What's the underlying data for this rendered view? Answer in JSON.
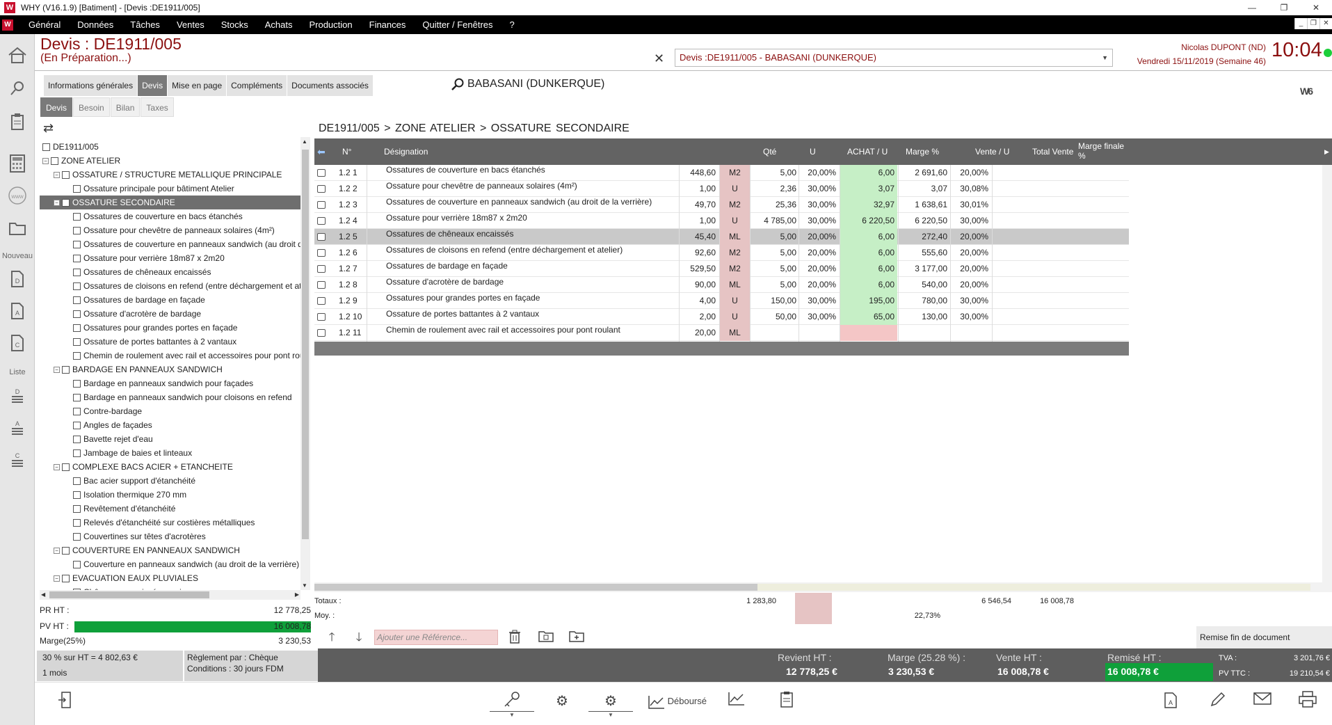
{
  "window": {
    "title": "WHY (V16.1.9)  [Batiment] - [Devis :DE1911/005]",
    "logo": "W",
    "controls": [
      "—",
      "❐",
      "✕"
    ]
  },
  "menu": {
    "items": [
      "Général",
      "Données",
      "Tâches",
      "Ventes",
      "Stocks",
      "Achats",
      "Production",
      "Finances",
      "Quitter / Fenêtres",
      "?"
    ],
    "mdi": [
      "_",
      "❐",
      "✕"
    ]
  },
  "rail": {
    "label_nouveau": "Nouveau",
    "label_liste": "Liste"
  },
  "header": {
    "title": "Devis : DE1911/005",
    "status": "(En Préparation...)",
    "doc_select": "Devis :DE1911/005 - BABASANI  (DUNKERQUE)",
    "user": "Nicolas DUPONT (ND)",
    "date": "Vendredi 15/11/2019 (Semaine 46)",
    "time": "10:04"
  },
  "tabs": {
    "main": [
      "Informations générales",
      "Devis",
      "Mise en page",
      "Compléments",
      "Documents associés"
    ],
    "sub": [
      "Devis",
      "Besoin",
      "Bilan",
      "Taxes"
    ]
  },
  "client": "BABASANI  (DUNKERQUE)",
  "brand_mark": "W6",
  "tree": [
    {
      "label": "DE1911/005",
      "level": 0,
      "exp": ""
    },
    {
      "label": "ZONE ATELIER",
      "level": 1,
      "exp": "−"
    },
    {
      "label": "OSSATURE / STRUCTURE METALLIQUE PRINCIPALE",
      "level": 2,
      "exp": "−"
    },
    {
      "label": "Ossature principale pour bâtiment Atelier",
      "level": 3,
      "exp": ""
    },
    {
      "label": "OSSATURE SECONDAIRE",
      "level": 2,
      "exp": "−",
      "selected": true
    },
    {
      "label": "Ossatures de couverture en bacs étanchés",
      "level": 3,
      "exp": ""
    },
    {
      "label": "Ossature pour chevêtre de panneaux solaires (4m²)",
      "level": 3,
      "exp": ""
    },
    {
      "label": "Ossatures de couverture en panneaux sandwich (au droit de la verrière)",
      "level": 3,
      "exp": ""
    },
    {
      "label": "Ossature pour verrière 18m87 x 2m20",
      "level": 3,
      "exp": ""
    },
    {
      "label": "Ossatures de chêneaux encaissés",
      "level": 3,
      "exp": ""
    },
    {
      "label": "Ossatures de cloisons en refend (entre déchargement et atelier)",
      "level": 3,
      "exp": ""
    },
    {
      "label": "Ossatures de bardage en façade",
      "level": 3,
      "exp": ""
    },
    {
      "label": "Ossature d'acrotère de bardage",
      "level": 3,
      "exp": ""
    },
    {
      "label": "Ossatures pour grandes portes en façade",
      "level": 3,
      "exp": ""
    },
    {
      "label": "Ossature de portes battantes à 2 vantaux",
      "level": 3,
      "exp": ""
    },
    {
      "label": "Chemin de roulement avec rail et accessoires pour pont roulant",
      "level": 3,
      "exp": ""
    },
    {
      "label": "BARDAGE EN PANNEAUX SANDWICH",
      "level": 2,
      "exp": "−"
    },
    {
      "label": "Bardage en panneaux sandwich pour façades",
      "level": 3,
      "exp": ""
    },
    {
      "label": "Bardage en panneaux sandwich pour cloisons en refend",
      "level": 3,
      "exp": ""
    },
    {
      "label": "Contre-bardage",
      "level": 3,
      "exp": ""
    },
    {
      "label": "Angles de façades",
      "level": 3,
      "exp": ""
    },
    {
      "label": "Bavette rejet d'eau",
      "level": 3,
      "exp": ""
    },
    {
      "label": "Jambage de baies et linteaux",
      "level": 3,
      "exp": ""
    },
    {
      "label": "COMPLEXE BACS ACIER + ETANCHEITE",
      "level": 2,
      "exp": "−"
    },
    {
      "label": "Bac acier support d'étanchéité",
      "level": 3,
      "exp": ""
    },
    {
      "label": "Isolation thermique 270 mm",
      "level": 3,
      "exp": ""
    },
    {
      "label": "Revêtement d'étanchéité",
      "level": 3,
      "exp": ""
    },
    {
      "label": "Relevés d'étanchéité sur costières métalliques",
      "level": 3,
      "exp": ""
    },
    {
      "label": "Couvertines sur têtes d'acrotères",
      "level": 3,
      "exp": ""
    },
    {
      "label": "COUVERTURE EN PANNEAUX SANDWICH",
      "level": 2,
      "exp": "−"
    },
    {
      "label": "Couverture en panneaux sandwich (au droit de la verrière)",
      "level": 3,
      "exp": ""
    },
    {
      "label": "EVACUATION EAUX PLUVIALES",
      "level": 2,
      "exp": "−"
    },
    {
      "label": "Chêneaux encaissé en acier",
      "level": 3,
      "exp": ""
    }
  ],
  "left_totals": {
    "pr_label": "PR HT :",
    "pr_value": "12 778,25",
    "pv_label": "PV HT :",
    "pv_value": "16 008,78",
    "marge_label": "Marge(25%)",
    "marge_value": "3 230,53",
    "pct_label": "30 % sur HT =  4 802,63 €",
    "duration": "1 mois",
    "reglement": "Règlement par :  Chèque",
    "conditions": "Conditions :  30 jours FDM"
  },
  "breadcrumb": "DE1911/005   > ZONE ATELIER   > OSSATURE SECONDAIRE",
  "grid": {
    "headers": [
      "N°",
      "Désignation",
      "Qté",
      "U",
      "ACHAT / U",
      "Marge %",
      "Vente / U",
      "Total Vente",
      "Marge finale %"
    ],
    "rows": [
      {
        "n": "1.2 1",
        "des": "Ossatures de couverture en bacs étanchés",
        "qte": "448,60",
        "u": "M2",
        "achat": "5,00",
        "marge": "20,00%",
        "vente": "6,00",
        "total": "2 691,60",
        "mf": "20,00%"
      },
      {
        "n": "1.2 2",
        "des": "Ossature pour chevêtre de panneaux solaires (4m²)",
        "qte": "1,00",
        "u": "U",
        "achat": "2,36",
        "marge": "30,00%",
        "vente": "3,07",
        "total": "3,07",
        "mf": "30,08%"
      },
      {
        "n": "1.2 3",
        "des": "Ossatures de couverture en panneaux sandwich (au droit de la verrière)",
        "qte": "49,70",
        "u": "M2",
        "achat": "25,36",
        "marge": "30,00%",
        "vente": "32,97",
        "total": "1 638,61",
        "mf": "30,01%"
      },
      {
        "n": "1.2 4",
        "des": "Ossature pour verrière 18m87 x 2m20",
        "qte": "1,00",
        "u": "U",
        "achat": "4 785,00",
        "marge": "30,00%",
        "vente": "6 220,50",
        "total": "6 220,50",
        "mf": "30,00%"
      },
      {
        "n": "1.2 5",
        "des": "Ossatures de chêneaux encaissés",
        "qte": "45,40",
        "u": "ML",
        "achat": "5,00",
        "marge": "20,00%",
        "vente": "6,00",
        "total": "272,40",
        "mf": "20,00%",
        "selected": true
      },
      {
        "n": "1.2 6",
        "des": "Ossatures de cloisons en refend (entre déchargement et atelier)",
        "qte": "92,60",
        "u": "M2",
        "achat": "5,00",
        "marge": "20,00%",
        "vente": "6,00",
        "total": "555,60",
        "mf": "20,00%"
      },
      {
        "n": "1.2 7",
        "des": "Ossatures de bardage en façade",
        "qte": "529,50",
        "u": "M2",
        "achat": "5,00",
        "marge": "20,00%",
        "vente": "6,00",
        "total": "3 177,00",
        "mf": "20,00%"
      },
      {
        "n": "1.2 8",
        "des": "Ossature d'acrotère de bardage",
        "qte": "90,00",
        "u": "ML",
        "achat": "5,00",
        "marge": "20,00%",
        "vente": "6,00",
        "total": "540,00",
        "mf": "20,00%"
      },
      {
        "n": "1.2 9",
        "des": "Ossatures pour grandes portes en façade",
        "qte": "4,00",
        "u": "U",
        "achat": "150,00",
        "marge": "30,00%",
        "vente": "195,00",
        "total": "780,00",
        "mf": "30,00%"
      },
      {
        "n": "1.2 10",
        "des": "Ossature de portes battantes à 2 vantaux",
        "qte": "2,00",
        "u": "U",
        "achat": "50,00",
        "marge": "30,00%",
        "vente": "65,00",
        "total": "130,00",
        "mf": "30,00%"
      },
      {
        "n": "1.2 11",
        "des": "Chemin de roulement avec rail et accessoires pour pont roulant",
        "qte": "20,00",
        "u": "ML",
        "achat": "",
        "marge": "",
        "vente": "",
        "total": "",
        "mf": "",
        "pending": true
      }
    ]
  },
  "totals": {
    "label": "Totaux :",
    "moy_label": "Moy. :",
    "qte": "1 283,80",
    "vente": "6 546,54",
    "total": "16 008,78",
    "moy_marge": "22,73%"
  },
  "toolbar": {
    "ref_placeholder": "Ajouter une Référence...",
    "remise_doc": "Remise fin de document"
  },
  "summary": {
    "revient_label": "Revient HT :",
    "revient_value": "12 778,25 €",
    "marge_label": "Marge (25.28 %) :",
    "marge_value": "3 230,53 €",
    "vente_label": "Vente HT :",
    "vente_value": "16 008,78 €",
    "remise_label": "Remisé HT :",
    "remise_value": "16 008,78 €",
    "tva_label": "TVA :",
    "tva_value": "3 201,76 €",
    "ttc_label": "PV TTC :",
    "ttc_value": "19 210,54 €"
  },
  "footer": {
    "debourse_label": "Déboursé"
  },
  "colors": {
    "accent": "#8b0f0f",
    "green": "#0fa03a",
    "header_gray": "#636363",
    "unit_pink": "#e6c4c4",
    "sale_green": "#c6efc6"
  }
}
